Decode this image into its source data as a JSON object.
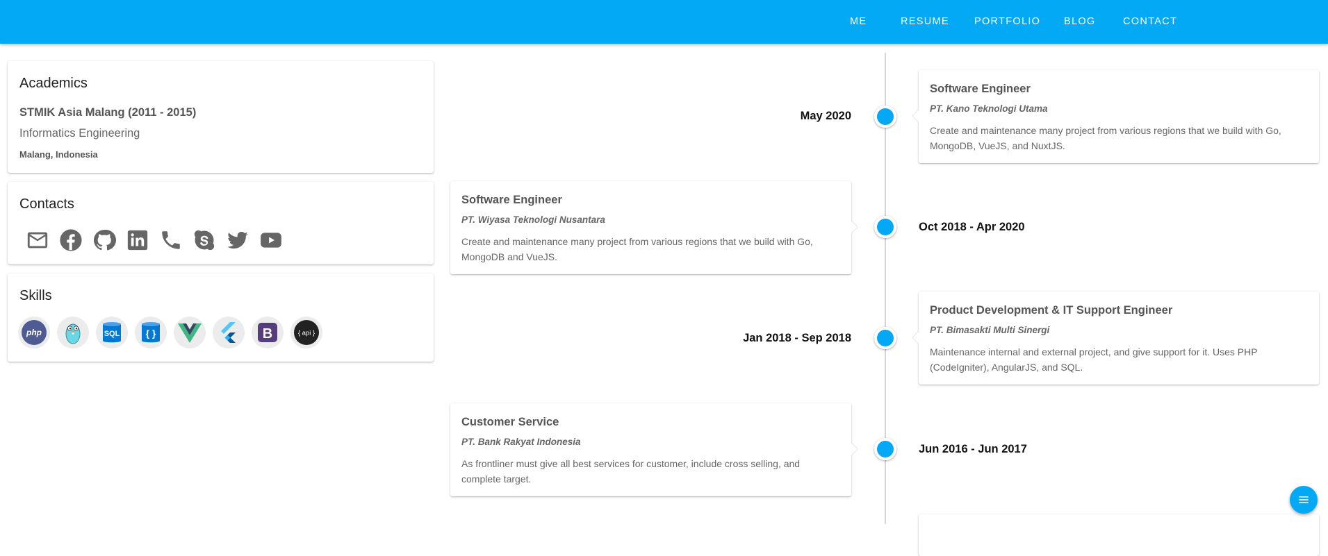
{
  "nav": {
    "items": [
      "ME",
      "RESUME",
      "PORTFOLIO",
      "BLOG",
      "CONTACT"
    ]
  },
  "academics": {
    "title": "Academics",
    "school": "STMIK Asia Malang (2011 - 2015)",
    "major": "Informatics Engineering",
    "location": "Malang, Indonesia"
  },
  "contacts": {
    "title": "Contacts",
    "icons": [
      "email-icon",
      "facebook-icon",
      "github-icon",
      "linkedin-icon",
      "phone-icon",
      "skype-icon",
      "twitter-icon",
      "youtube-icon"
    ]
  },
  "skills": {
    "title": "Skills",
    "items": [
      "php",
      "go",
      "SQL",
      "{ }",
      "vue",
      "flutter",
      "B",
      "{ api }"
    ]
  },
  "timeline": [
    {
      "date": "May 2020",
      "title": "Software Engineer",
      "company": "PT. Kano Teknologi Utama",
      "description": "Create and maintenance many project from various regions that we build with Go, MongoDB, VueJS, and NuxtJS."
    },
    {
      "date": "Oct 2018 - Apr 2020",
      "title": "Software Engineer",
      "company": "PT. Wiyasa Teknologi Nusantara",
      "description": "Create and maintenance many project from various regions that we build with Go, MongoDB and VueJS."
    },
    {
      "date": "Jan 2018 - Sep 2018",
      "title": "Product Development & IT Support Engineer",
      "company": "PT. Bimasakti Multi Sinergi",
      "description": "Maintenance internal and external project, and give support for it. Uses PHP (CodeIgniter), AngularJS, and SQL."
    },
    {
      "date": "Jun 2016 - Jun 2017",
      "title": "Customer Service",
      "company": "PT. Bank Rakyat Indonesia",
      "description": "As frontliner must give all best services for customer, include cross selling, and complete target."
    }
  ],
  "colors": {
    "primary": "#03a9f4",
    "icon_gray": "#666666"
  },
  "fab": {
    "icon": "menu-icon"
  }
}
